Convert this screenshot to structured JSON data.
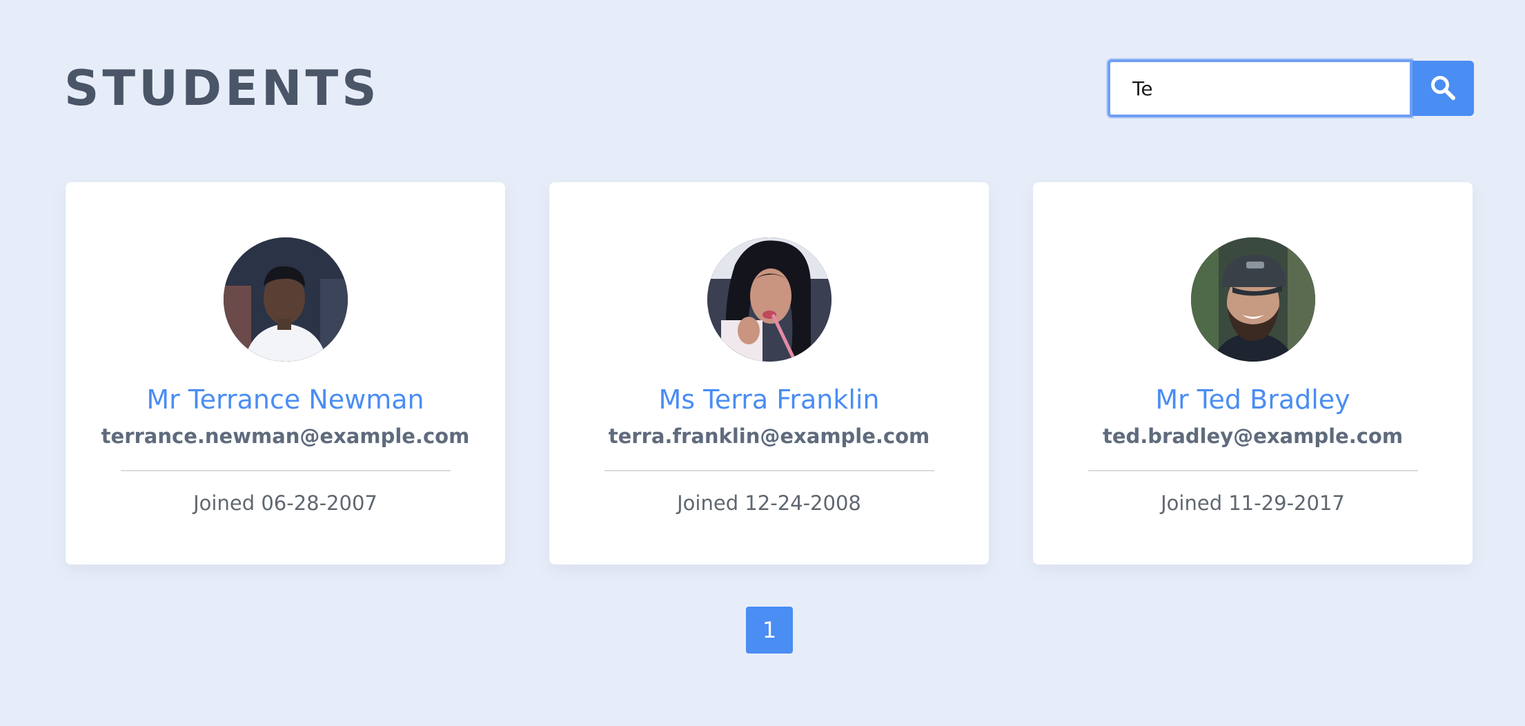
{
  "header": {
    "title": "STUDENTS"
  },
  "search": {
    "value": "Te",
    "button_icon": "search-icon"
  },
  "students": [
    {
      "name": "Mr Terrance Newman",
      "email": "terrance.newman@example.com",
      "joined": "Joined 06-28-2007",
      "avatar": "avatar-photo"
    },
    {
      "name": "Ms Terra Franklin",
      "email": "terra.franklin@example.com",
      "joined": "Joined 12-24-2008",
      "avatar": "avatar-photo"
    },
    {
      "name": "Mr Ted Bradley",
      "email": "ted.bradley@example.com",
      "joined": "Joined 11-29-2017",
      "avatar": "avatar-photo"
    }
  ],
  "pagination": {
    "pages": [
      "1"
    ],
    "current": "1"
  },
  "colors": {
    "background": "#e7edf8",
    "accent": "#4a8df3",
    "title": "#4a5568",
    "card": "#ffffff"
  }
}
